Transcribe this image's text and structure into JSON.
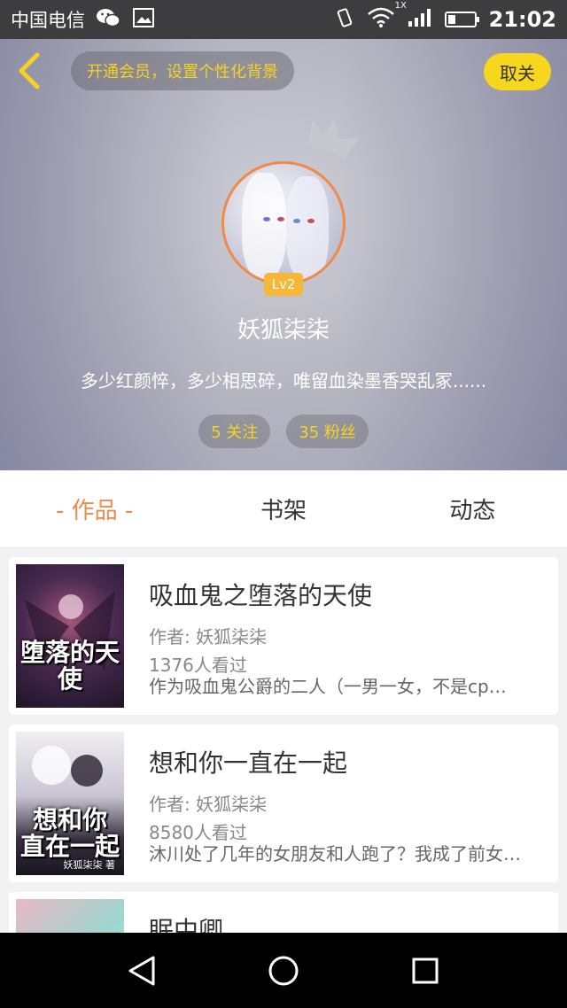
{
  "status_bar": {
    "carrier": "中国电信",
    "network_label": "1X",
    "time": "21:02"
  },
  "header": {
    "vip_prompt": "开通会员，设置个性化背景",
    "unfollow_label": "取关"
  },
  "profile": {
    "level": "Lv2",
    "username": "妖狐柒柒",
    "bio": "多少红颜悴，多少相思碎，唯留血染墨香哭乱冢......",
    "following": "5 关注",
    "followers": "35 粉丝"
  },
  "tabs": [
    {
      "label": "- 作品 -",
      "active": true
    },
    {
      "label": "书架",
      "active": false
    },
    {
      "label": "动态",
      "active": false
    }
  ],
  "books": [
    {
      "title": "吸血鬼之堕落的天使",
      "author": "作者: 妖狐柒柒",
      "views": "1376人看过",
      "desc": "作为吸血鬼公爵的二人（一男一女，不是cp…",
      "cover_text": "堕落的天使",
      "cover_author": ""
    },
    {
      "title": "想和你一直在一起",
      "author": "作者: 妖狐柒柒",
      "views": "8580人看过",
      "desc": "沐川处了几年的女朋友和人跑了？我成了前女…",
      "cover_text": "想和你 直在一起",
      "cover_author": "妖狐柒柒 著"
    },
    {
      "title": "眠中卿",
      "author": "",
      "views": "",
      "desc": "",
      "cover_text": "",
      "cover_author": ""
    }
  ],
  "colors": {
    "accent_orange": "#f08a4b",
    "accent_yellow": "#f7d71e",
    "vip_text": "#f5d322"
  }
}
